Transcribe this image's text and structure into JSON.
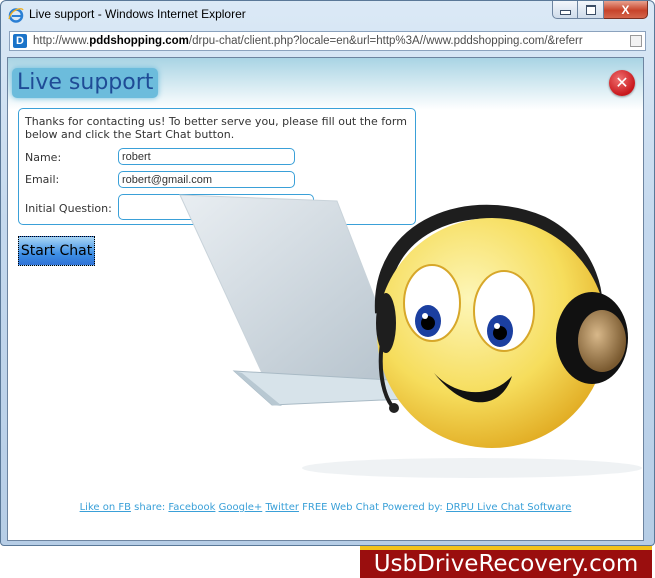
{
  "window": {
    "title": "Live support - Windows Internet Explorer",
    "controls": {
      "minimize": "minimize",
      "maximize": "maximize",
      "close": "X"
    }
  },
  "address_bar": {
    "prefix": "http://www.",
    "domain": "pddshopping.com",
    "path": "/drpu-chat/client.php?locale=en&url=http%3A//www.pddshopping.com/&referr"
  },
  "page": {
    "title": "Live support",
    "close_label": "✕",
    "intro": "Thanks for contacting us! To better serve you, please fill out the form below and click the Start Chat button.",
    "form": {
      "name_label": "Name:",
      "name_value": "robert",
      "email_label": "Email:",
      "email_value": "robert@gmail.com",
      "question_label": "Initial Question:",
      "question_value": ""
    },
    "start_chat_label": "Start Chat",
    "footer": {
      "like_fb": "Like on FB",
      "share_text": " share: ",
      "facebook": "Facebook",
      "google": "Google+",
      "twitter": "Twitter",
      "powered_text": " FREE Web Chat Powered by: ",
      "drpu": "DRPU Live Chat Software"
    }
  },
  "brand": {
    "text": "UsbDriveRecovery.com",
    "colors": {
      "bg": "#9a0e0e",
      "stripe": "#f2c21a"
    }
  }
}
